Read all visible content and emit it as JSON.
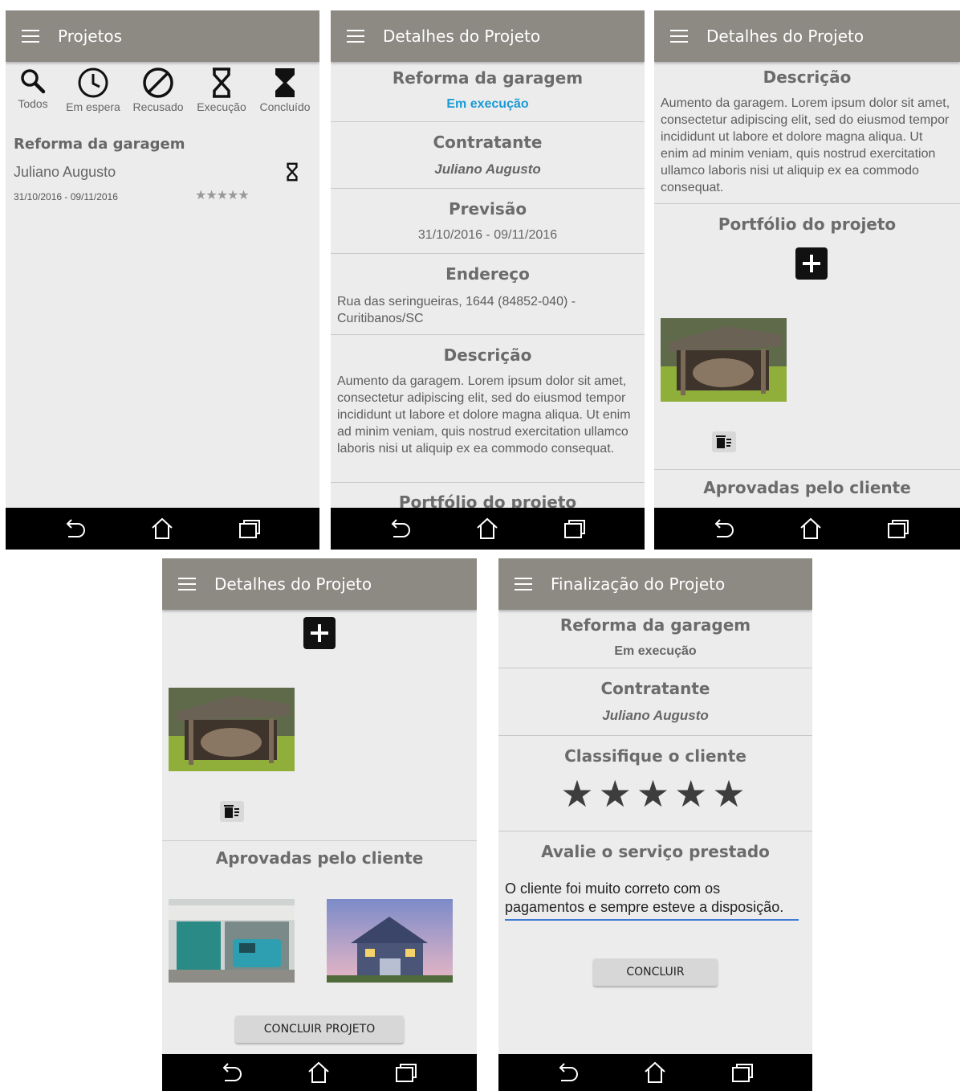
{
  "screens": {
    "projects": {
      "title": "Projetos",
      "filters": [
        "Todos",
        "Em espera",
        "Recusado",
        "Execução",
        "Concluído"
      ],
      "item": {
        "name": "Reforma da garagem",
        "client": "Juliano Augusto",
        "dates": "31/10/2016 - 09/11/2016",
        "status_icon": "hourglass-icon",
        "rating_stars": "★★★★★"
      }
    },
    "details1": {
      "title": "Detalhes do Projeto",
      "project_name": "Reforma da garagem",
      "status": "Em execução",
      "contractor_label": "Contratante",
      "contractor": "Juliano Augusto",
      "forecast_label": "Previsão",
      "forecast": "31/10/2016 - 09/11/2016",
      "address_label": "Endereço",
      "address": "Rua das seringueiras, 1644 (84852-040) - Curitibanos/SC",
      "description_label": "Descrição",
      "description": "Aumento da garagem. Lorem ipsum dolor sit amet, consectetur adipiscing elit, sed do eiusmod tempor incididunt ut labore et dolore magna aliqua. Ut enim ad minim veniam, quis nostrud exercitation ullamco laboris nisi ut aliquip ex ea commodo consequat.",
      "portfolio_label": "Portfólio do projeto"
    },
    "details2": {
      "title": "Detalhes do Projeto",
      "description_label": "Descrição",
      "description": "Aumento da garagem. Lorem ipsum dolor sit amet, consectetur adipiscing elit, sed do eiusmod tempor incididunt ut labore et dolore magna aliqua. Ut enim ad minim veniam, quis nostrud exercitation ullamco laboris nisi ut aliquip ex ea commodo consequat.",
      "portfolio_label": "Portfólio do projeto",
      "approved_label": "Aprovadas pelo cliente"
    },
    "details3": {
      "title": "Detalhes do Projeto",
      "approved_label": "Aprovadas pelo cliente",
      "button": "CONCLUIR PROJETO"
    },
    "finalize": {
      "title": "Finalização do Projeto",
      "project_name": "Reforma da garagem",
      "status": "Em execução",
      "contractor_label": "Contratante",
      "contractor": "Juliano Augusto",
      "rate_label": "Classifique o cliente",
      "stars": [
        "★",
        "★",
        "★",
        "★",
        "★"
      ],
      "review_label": "Avalie o serviço prestado",
      "review_text": "O cliente foi muito correto com os pagamentos e sempre esteve a disposição.",
      "button": "CONCLUIR"
    }
  },
  "colors": {
    "appbar": "#8d8a84",
    "status_accent": "#1a9ad6",
    "background": "#ececec",
    "input_line": "#3f7bd6"
  }
}
